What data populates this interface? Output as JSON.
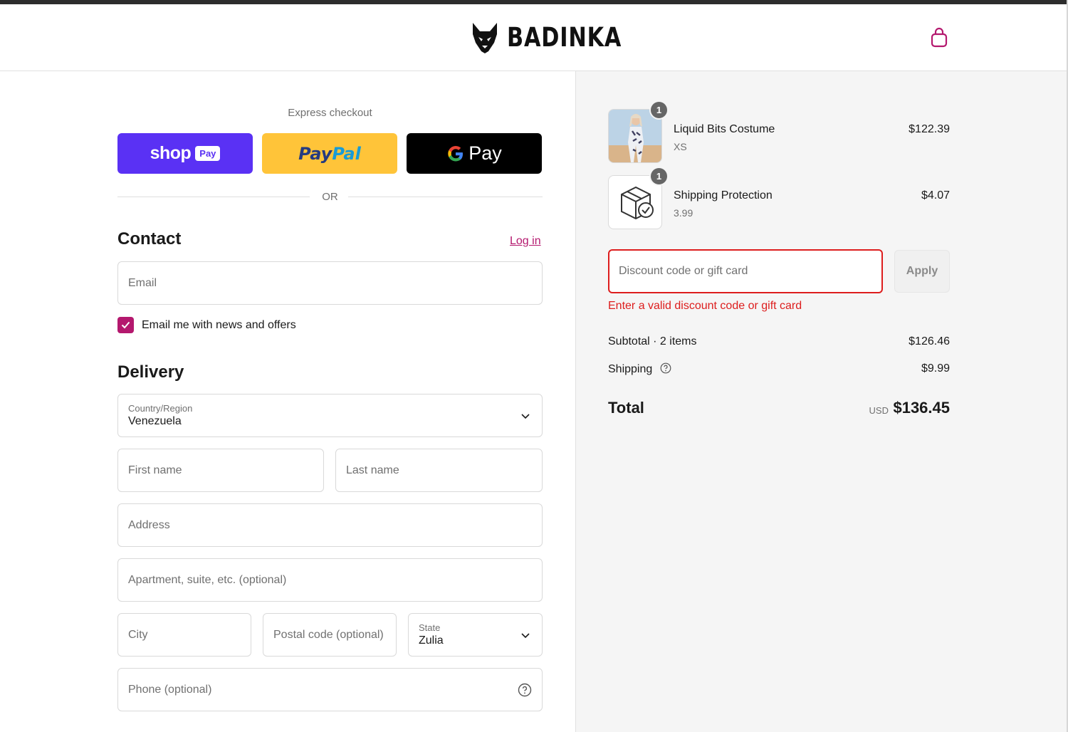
{
  "header": {
    "brand": "BADINKA",
    "cart_icon": "shopping-bag-icon",
    "accent_color": "#b4186e"
  },
  "express": {
    "label": "Express checkout",
    "shop_pay": {
      "word": "shop",
      "tag": "Pay",
      "color": "#5a31f4"
    },
    "paypal": {
      "part1": "Pay",
      "part2": "Pal",
      "color": "#ffc439"
    },
    "google_pay": {
      "g": "G",
      "word": "Pay",
      "color": "#000000"
    },
    "or": "OR"
  },
  "contact": {
    "title": "Contact",
    "login": "Log in",
    "email_placeholder": "Email",
    "newsletter_label": "Email me with news and offers",
    "newsletter_checked": true
  },
  "delivery": {
    "title": "Delivery",
    "country_label": "Country/Region",
    "country_value": "Venezuela",
    "first_name_placeholder": "First name",
    "last_name_placeholder": "Last name",
    "address_placeholder": "Address",
    "apartment_placeholder": "Apartment, suite, etc. (optional)",
    "city_placeholder": "City",
    "postal_placeholder": "Postal code (optional)",
    "state_label": "State",
    "state_value": "Zulia",
    "phone_placeholder": "Phone (optional)"
  },
  "summary": {
    "items": [
      {
        "qty": "1",
        "name": "Liquid Bits Costume",
        "variant": "XS",
        "price": "$122.39"
      },
      {
        "qty": "1",
        "name": "Shipping Protection",
        "variant": "3.99",
        "price": "$4.07"
      }
    ],
    "discount_placeholder": "Discount code or gift card",
    "apply_label": "Apply",
    "discount_error": "Enter a valid discount code or gift card",
    "error_color": "#dd1d1d",
    "subtotal_label": "Subtotal · 2 items",
    "subtotal_value": "$126.46",
    "shipping_label": "Shipping",
    "shipping_value": "$9.99",
    "total_label": "Total",
    "currency": "USD",
    "total_value": "$136.45"
  }
}
